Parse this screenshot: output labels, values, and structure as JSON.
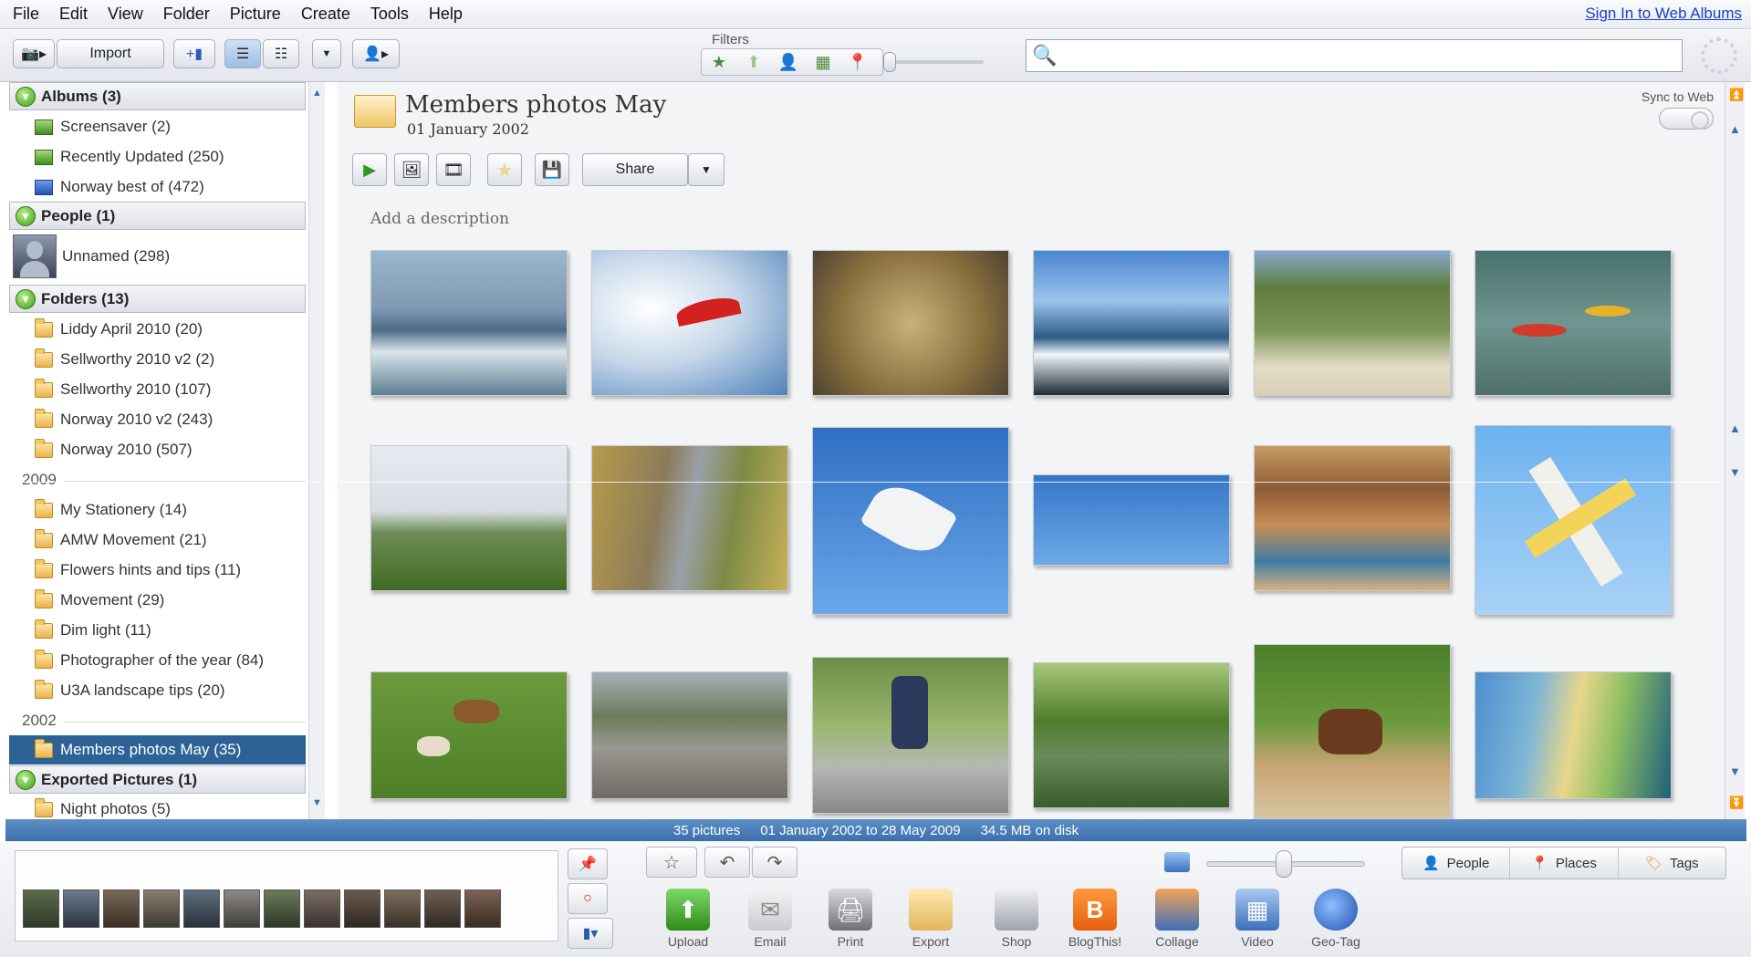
{
  "menu": [
    "File",
    "Edit",
    "View",
    "Folder",
    "Picture",
    "Create",
    "Tools",
    "Help"
  ],
  "signin": "Sign In to Web Albums",
  "toolbar": {
    "import_label": "Import",
    "filters_label": "Filters"
  },
  "colors": {
    "selected": "#2d6296",
    "status_bar": "#4a7fbb",
    "link": "#1a3fc4"
  },
  "sidebar": {
    "albums_header": "Albums (3)",
    "albums": [
      "Screensaver (2)",
      "Recently Updated (250)",
      "Norway best of (472)"
    ],
    "people_header": "People (1)",
    "people": [
      "Unnamed (298)"
    ],
    "folders_header": "Folders (13)",
    "folders_recent": [
      "Liddy April 2010 (20)",
      "Sellworthy 2010 v2 (2)",
      "Sellworthy 2010 (107)",
      "Norway 2010 v2 (243)",
      "Norway 2010 (507)"
    ],
    "year_2009": "2009",
    "folders_2009": [
      "My Stationery (14)",
      "AMW Movement (21)",
      "Flowers hints and tips (11)",
      "Movement (29)",
      "Dim light (11)",
      "Photographer of the year (84)",
      "U3A landscape tips (20)"
    ],
    "year_2002": "2002",
    "folders_2002": [
      "Members photos May (35)"
    ],
    "exported_header": "Exported Pictures (1)",
    "exported": [
      "Night photos (5)"
    ]
  },
  "album": {
    "title": "Members photos May",
    "date": "01 January 2002",
    "sync_label": "Sync to Web",
    "share_label": "Share",
    "description_placeholder": "Add a description"
  },
  "photos": [
    "surfers",
    "paraglider",
    "ducks-in-water",
    "sea-waves",
    "elephants",
    "kayakers",
    "birds-over-field",
    "car-motion",
    "seagull",
    "two-seagulls",
    "carousel",
    "red-plane",
    "dogs-running",
    "motorbike",
    "boy-cycling",
    "river-with-trees",
    "horse-rider",
    "wave-sunset"
  ],
  "status": {
    "count": "35 pictures",
    "range": "01 January 2002 to 28 May 2009",
    "size": "34.5 MB on disk"
  },
  "actions": [
    "Upload",
    "Email",
    "Print",
    "Export",
    "Shop",
    "BlogThis!",
    "Collage",
    "Video",
    "Geo-Tag"
  ],
  "tray_tabs": [
    "People",
    "Places",
    "Tags"
  ]
}
